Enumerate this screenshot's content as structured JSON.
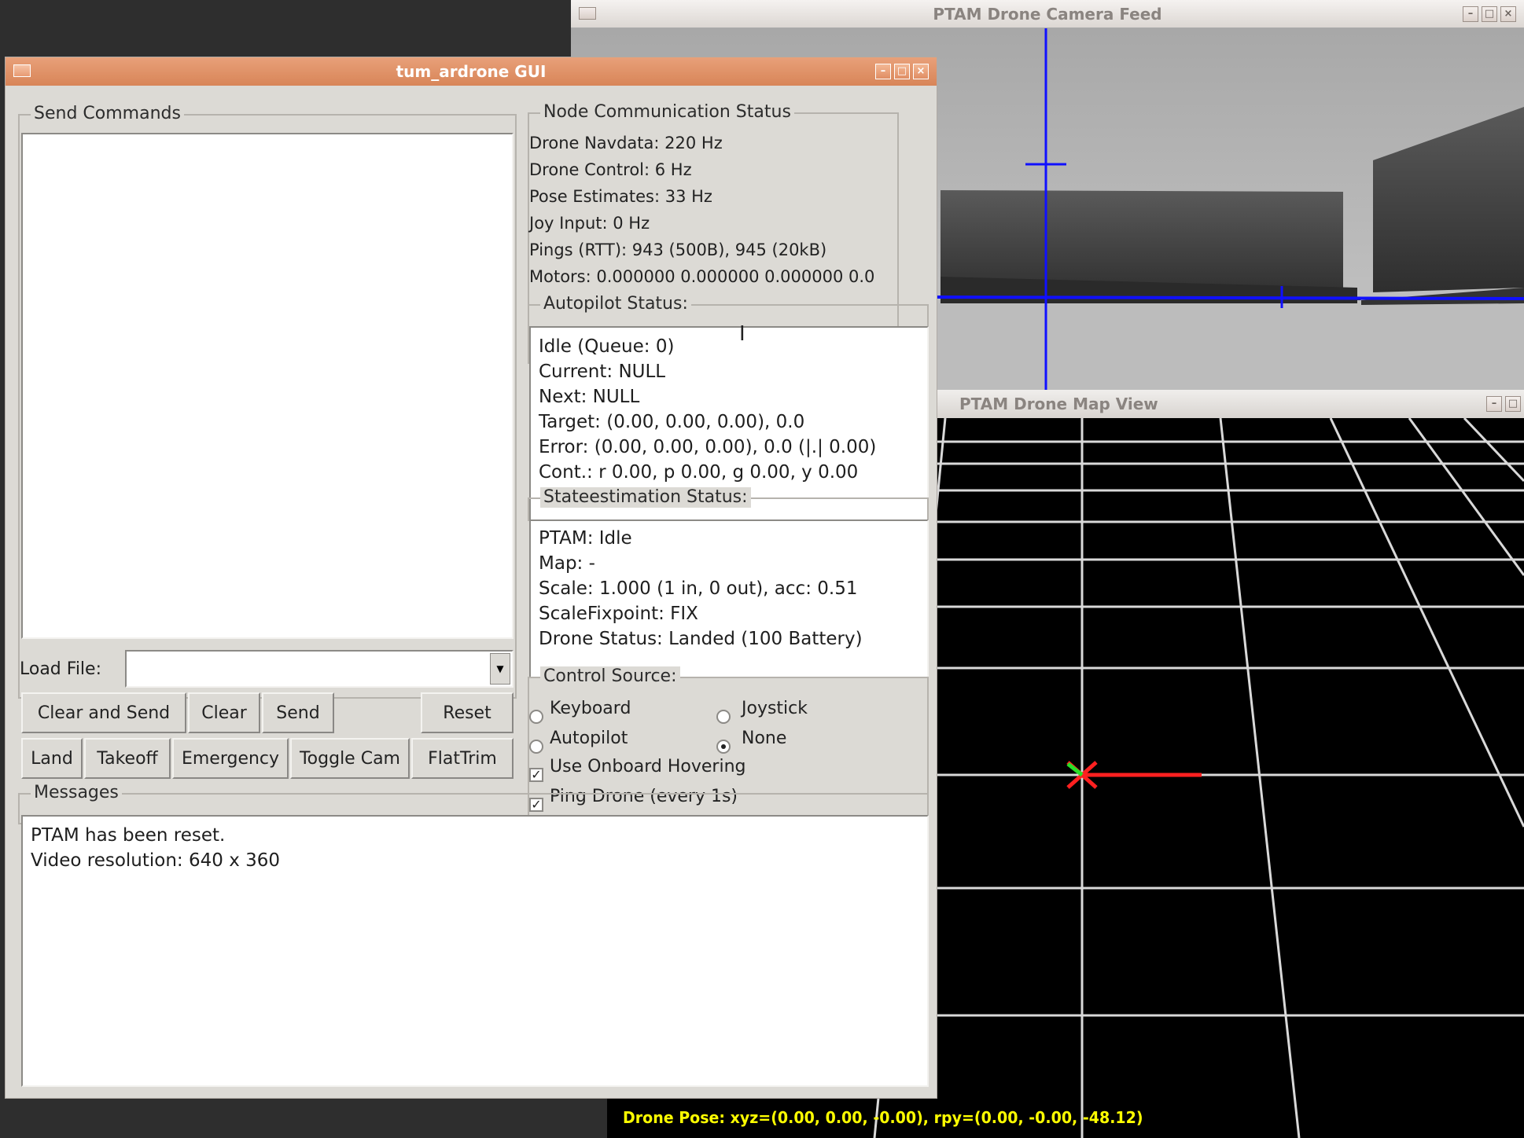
{
  "camera_window": {
    "title": "PTAM Drone Camera Feed"
  },
  "map_window": {
    "title": "PTAM Drone Map View",
    "pose_readout": "Drone Pose:   xyz=(0.00,   0.00,  -0.00),     rpy=(0.00,   -0.00,  -48.12)",
    "colors": {
      "background": "#000000",
      "grid": "#d9d9d9",
      "axis_x": "#ff2020",
      "axis_y": "#28e028",
      "readout": "#ffff00"
    }
  },
  "gui_window": {
    "title": "tum_ardrone GUI",
    "send_commands": {
      "title": "Send Commands",
      "load_file_label": "Load File:",
      "load_file_value": "",
      "dropdown_arrow_icon": "chevron-down-icon",
      "buttons_row1": [
        "Clear and Send",
        "Clear",
        "Send",
        "Reset"
      ],
      "buttons_row2": [
        "Land",
        "Takeoff",
        "Emergency",
        "Toggle Cam",
        "FlatTrim"
      ]
    },
    "node_status": {
      "title": "Node Communication  Status",
      "lines": [
        "Drone Navdata: 220 Hz",
        "Drone Control: 6 Hz",
        "Pose Estimates: 33 Hz",
        "Joy Input: 0 Hz",
        "Pings (RTT): 943 (500B), 945 (20kB)",
        "Motors: 0.000000 0.000000 0.000000 0.0"
      ]
    },
    "autopilot_status": {
      "title": "Autopilot Status:",
      "lines": [
        "Idle (Queue: 0)",
        "Current: NULL",
        "Next: NULL",
        "Target: (0.00,  0.00,  0.00), 0.0",
        "Error: (0.00,  0.00,  0.00), 0.0 (|.| 0.00)",
        "Cont.: r 0.00, p 0.00, g 0.00, y 0.00"
      ]
    },
    "stateestimation_status": {
      "title": "Stateestimation Status:",
      "lines": [
        "PTAM: Idle",
        "Map: -",
        "Scale: 1.000 (1 in, 0 out), acc: 0.51",
        "ScaleFixpoint: FIX",
        "Drone Status: Landed (100 Battery)"
      ]
    },
    "control_source": {
      "title": "Control Source:",
      "keyboard": "Keyboard",
      "joystick": "Joystick",
      "autopilot": "Autopilot",
      "none": "None",
      "selected": "None",
      "use_onboard_hovering": "Use Onboard Hovering",
      "ping_drone": "Ping Drone (every 1s)",
      "use_onboard_hovering_checked": true,
      "ping_drone_checked": true
    },
    "messages": {
      "title": "Messages",
      "lines": [
        "PTAM has been reset.",
        "Video resolution: 640 x 360"
      ]
    }
  }
}
